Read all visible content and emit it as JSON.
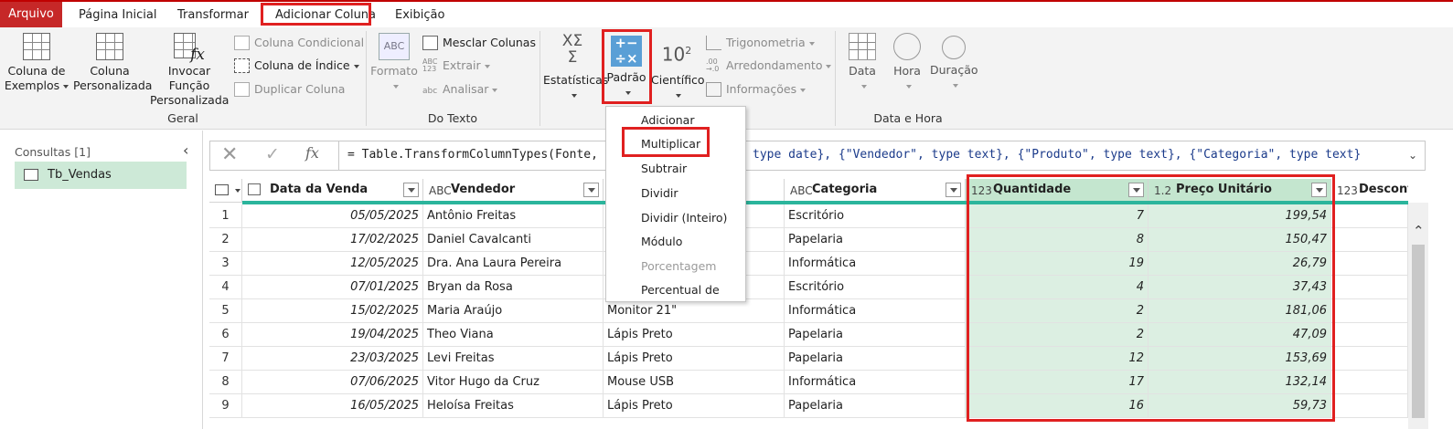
{
  "tabs": [
    {
      "label": "Arquivo"
    },
    {
      "label": "Página Inicial"
    },
    {
      "label": "Transformar"
    },
    {
      "label": "Adicionar Coluna"
    },
    {
      "label": "Exibição"
    }
  ],
  "ribbon": {
    "geral": {
      "label": "Geral",
      "col_examples": "Coluna de\nExemplos",
      "col_custom": "Coluna\nPersonalizada",
      "invoke_fn": "Invocar Função\nPersonalizada",
      "cond_col": "Coluna Condicional",
      "index_col": "Coluna de Índice",
      "dup_col": "Duplicar Coluna"
    },
    "text": {
      "label": "Do Texto",
      "format": "Formato",
      "merge": "Mesclar Colunas",
      "extract": "Extrair",
      "parse": "Analisar"
    },
    "number": {
      "stats": "Estatísticas",
      "standard": "Padrão",
      "scientific": "Científico",
      "trig": "Trigonometria",
      "rounding": "Arredondamento",
      "info": "Informações"
    },
    "datetime": {
      "label": "Data e Hora",
      "date": "Data",
      "time": "Hora",
      "duration": "Duração"
    }
  },
  "dropdown": {
    "items": [
      "Adicionar",
      "Multiplicar",
      "Subtrair",
      "Dividir",
      "Dividir (Inteiro)",
      "Módulo",
      "Porcentagem",
      "Percentual de"
    ]
  },
  "queries": {
    "title": "Consultas [1]",
    "item": "Tb_Vendas"
  },
  "formula": {
    "text_left": "= Table.TransformColumnTypes(Fonte,",
    "text_right": "type date}, {\"Vendedor\", type text}, {\"Produto\", type text}, {\"Categoria\", type text}"
  },
  "table": {
    "headers": {
      "date": "Data da Venda",
      "seller": "Vendedor",
      "category": "Categoria",
      "qty": "Quantidade",
      "price": "Preço Unitário",
      "discount": "Desconto (%"
    },
    "types": {
      "date": "",
      "text": "ABC",
      "int": "123",
      "dec": "1.2"
    },
    "rows": [
      {
        "n": "1",
        "date": "05/05/2025",
        "seller": "Antônio Freitas",
        "product": "",
        "category": "Escritório",
        "qty": "7",
        "price": "199,54"
      },
      {
        "n": "2",
        "date": "17/02/2025",
        "seller": "Daniel Cavalcanti",
        "product": "",
        "category": "Papelaria",
        "qty": "8",
        "price": "150,47"
      },
      {
        "n": "3",
        "date": "12/05/2025",
        "seller": "Dra. Ana Laura Pereira",
        "product": "",
        "category": "Informática",
        "qty": "19",
        "price": "26,79"
      },
      {
        "n": "4",
        "date": "07/01/2025",
        "seller": "Bryan da Rosa",
        "product": "",
        "category": "Escritório",
        "qty": "4",
        "price": "37,43"
      },
      {
        "n": "5",
        "date": "15/02/2025",
        "seller": "Maria Araújo",
        "product": "Monitor 21\"",
        "category": "Informática",
        "qty": "2",
        "price": "181,06"
      },
      {
        "n": "6",
        "date": "19/04/2025",
        "seller": "Theo Viana",
        "product": "Lápis Preto",
        "category": "Papelaria",
        "qty": "2",
        "price": "47,09"
      },
      {
        "n": "7",
        "date": "23/03/2025",
        "seller": "Levi Freitas",
        "product": "Lápis Preto",
        "category": "Papelaria",
        "qty": "12",
        "price": "153,69"
      },
      {
        "n": "8",
        "date": "07/06/2025",
        "seller": "Vitor Hugo da Cruz",
        "product": "Mouse USB",
        "category": "Informática",
        "qty": "17",
        "price": "132,14"
      },
      {
        "n": "9",
        "date": "16/05/2025",
        "seller": "Heloísa Freitas",
        "product": "Lápis Preto",
        "category": "Papelaria",
        "qty": "16",
        "price": "59,73"
      }
    ]
  },
  "colors": {
    "file_tab": "#c62828",
    "highlight": "#e02020",
    "quality_bar": "#2bb59c",
    "selected_col": "#dcefe2"
  }
}
